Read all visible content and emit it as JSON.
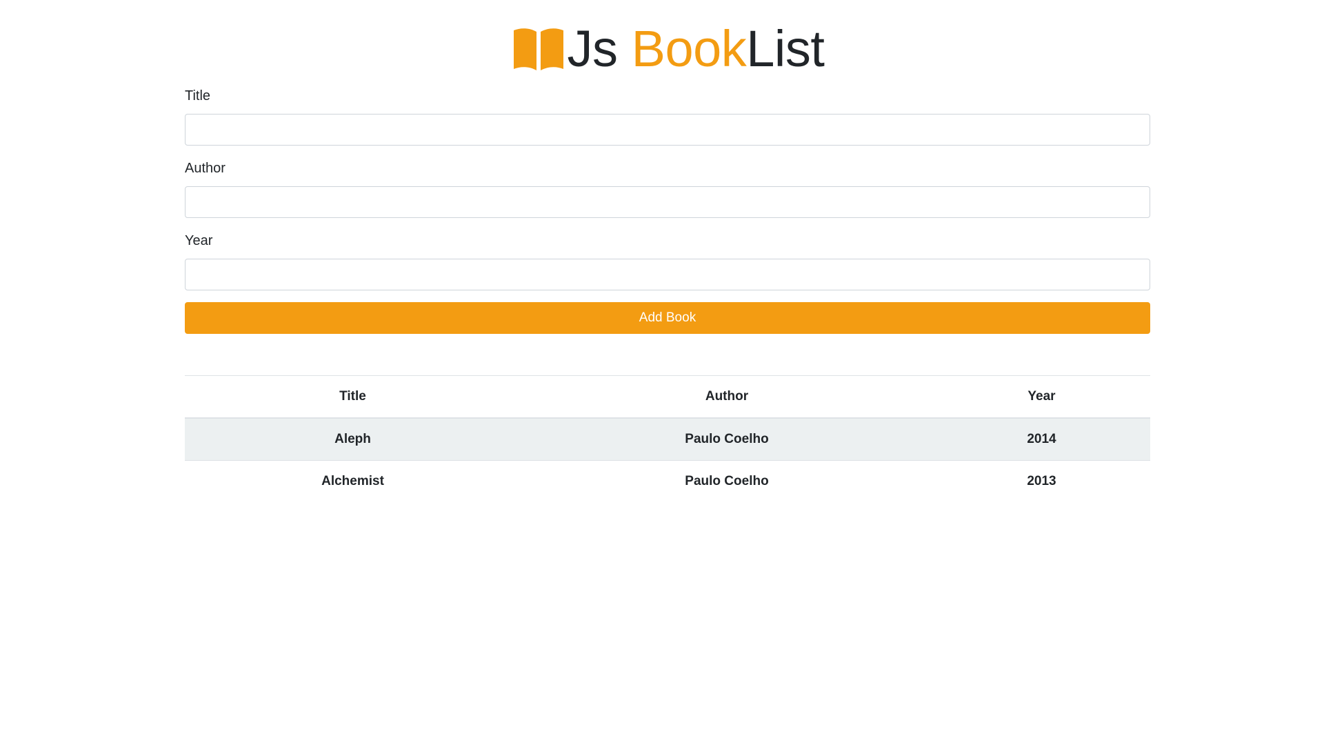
{
  "brand": {
    "prefix": "Js ",
    "accent": "Book",
    "suffix": "List",
    "icon": "open-book-icon",
    "accent_color": "#f39c12"
  },
  "form": {
    "title_label": "Title",
    "title_value": "",
    "author_label": "Author",
    "author_value": "",
    "year_label": "Year",
    "year_value": "",
    "submit_label": "Add Book",
    "submit_color": "#f39c12"
  },
  "table": {
    "headers": [
      "Title",
      "Author",
      "Year"
    ],
    "rows": [
      [
        "Aleph",
        "Paulo Coelho",
        "2014"
      ],
      [
        "Alchemist",
        "Paulo Coelho",
        "2013"
      ]
    ],
    "striped_color": "#ecf0f1"
  }
}
